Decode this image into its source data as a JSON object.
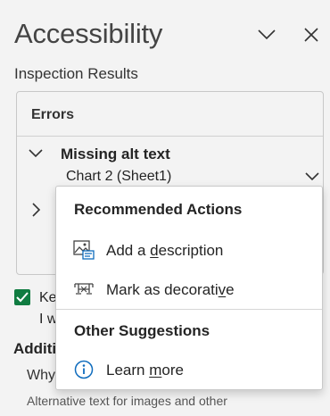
{
  "pane": {
    "title": "Accessibility",
    "collapse_icon": "chevron-down-icon",
    "close_icon": "close-icon"
  },
  "inspection": {
    "label": "Inspection Results",
    "errors_label": "Errors",
    "category": {
      "label": "Missing alt text",
      "expanded": true,
      "item": "Chart 2 (Sheet1)"
    }
  },
  "keep_option": {
    "checked": true,
    "line1": "Ke",
    "line2": "I w"
  },
  "additional": {
    "heading": "Additi",
    "why": "Why",
    "desc_line1": "Alternative text for images and other"
  },
  "menu": {
    "recommended_heading": "Recommended Actions",
    "add_description": {
      "pre": "Add a ",
      "accel": "d",
      "post": "escription",
      "icon": "image-description-icon"
    },
    "mark_decorative": {
      "pre": "Mark as decorati",
      "accel": "v",
      "post": "e",
      "icon": "decorative-icon"
    },
    "other_heading": "Other Suggestions",
    "learn_more": {
      "pre": "Learn ",
      "accel": "m",
      "post": "ore",
      "icon": "info-icon"
    }
  },
  "colors": {
    "accent_green": "#107c41",
    "info_blue": "#0f6cbd"
  }
}
